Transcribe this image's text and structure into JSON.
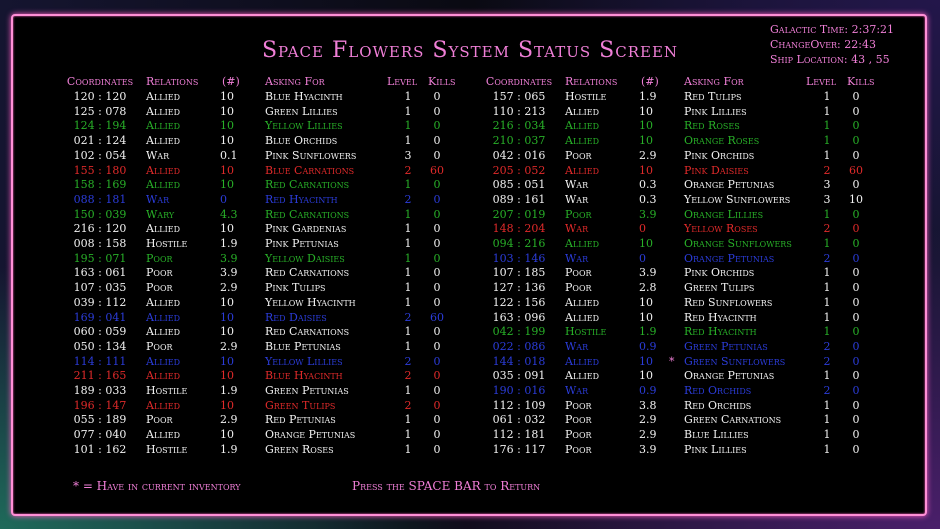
{
  "title": "Space Flowers System Status Screen",
  "status": {
    "galactic_time": "Galactic Time: 2:37:21",
    "changeover": "ChangeOver: 22:43",
    "ship_location": "Ship Location: 43 , 55"
  },
  "headers": {
    "coordinates": "Coordinates",
    "relations": "Relations",
    "num": "(#)",
    "asking_for": "Asking For",
    "level": "Level",
    "kills": "Kills"
  },
  "colors": {
    "white": "#f2f2f2",
    "green": "#28b028",
    "red": "#e02a2a",
    "blue": "#2b3cd9",
    "pink": "#f07fd7"
  },
  "left_rows": [
    {
      "coord": "120 : 120",
      "rel": "Allied",
      "num": "10",
      "ask": "Blue Hyacinth",
      "lvl": "1",
      "kills": "0",
      "color": "white"
    },
    {
      "coord": "125 : 078",
      "rel": "Allied",
      "num": "10",
      "ask": "Green Lillies",
      "lvl": "1",
      "kills": "0",
      "color": "white"
    },
    {
      "coord": "124 : 194",
      "rel": "Allied",
      "num": "10",
      "ask": "Yellow Lillies",
      "lvl": "1",
      "kills": "0",
      "color": "green"
    },
    {
      "coord": "021 : 124",
      "rel": "Allied",
      "num": "10",
      "ask": "Blue Orchids",
      "lvl": "1",
      "kills": "0",
      "color": "white"
    },
    {
      "coord": "102 : 054",
      "rel": "War",
      "num": "0.1",
      "ask": "Pink Sunflowers",
      "lvl": "3",
      "kills": "0",
      "color": "white"
    },
    {
      "coord": "155 : 180",
      "rel": "Allied",
      "num": "10",
      "ask": "Blue Carnations",
      "lvl": "2",
      "kills": "60",
      "color": "red"
    },
    {
      "coord": "158 : 169",
      "rel": "Allied",
      "num": "10",
      "ask": "Red Carnations",
      "lvl": "1",
      "kills": "0",
      "color": "green"
    },
    {
      "coord": "088 : 181",
      "rel": "War",
      "num": "0",
      "ask": "Red Hyacinth",
      "lvl": "2",
      "kills": "0",
      "color": "blue"
    },
    {
      "coord": "150 : 039",
      "rel": "Wary",
      "num": "4.3",
      "ask": "Red Carnations",
      "lvl": "1",
      "kills": "0",
      "color": "green"
    },
    {
      "coord": "216 : 120",
      "rel": "Allied",
      "num": "10",
      "ask": "Pink Gardenias",
      "lvl": "1",
      "kills": "0",
      "color": "white"
    },
    {
      "coord": "008 : 158",
      "rel": "Hostile",
      "num": "1.9",
      "ask": "Pink Petunias",
      "lvl": "1",
      "kills": "0",
      "color": "white"
    },
    {
      "coord": "195 : 071",
      "rel": "Poor",
      "num": "3.9",
      "ask": "Yellow Daisies",
      "lvl": "1",
      "kills": "0",
      "color": "green"
    },
    {
      "coord": "163 : 061",
      "rel": "Poor",
      "num": "3.9",
      "ask": "Red Carnations",
      "lvl": "1",
      "kills": "0",
      "color": "white"
    },
    {
      "coord": "107 : 035",
      "rel": "Poor",
      "num": "2.9",
      "ask": "Pink Tulips",
      "lvl": "1",
      "kills": "0",
      "color": "white"
    },
    {
      "coord": "039 : 112",
      "rel": "Allied",
      "num": "10",
      "ask": "Yellow Hyacinth",
      "lvl": "1",
      "kills": "0",
      "color": "white"
    },
    {
      "coord": "169 : 041",
      "rel": "Allied",
      "num": "10",
      "ask": "Red Daisies",
      "lvl": "2",
      "kills": "60",
      "color": "blue"
    },
    {
      "coord": "060 : 059",
      "rel": "Allied",
      "num": "10",
      "ask": "Red Carnations",
      "lvl": "1",
      "kills": "0",
      "color": "white"
    },
    {
      "coord": "050 : 134",
      "rel": "Poor",
      "num": "2.9",
      "ask": "Blue Petunias",
      "lvl": "1",
      "kills": "0",
      "color": "white"
    },
    {
      "coord": "114 : 111",
      "rel": "Allied",
      "num": "10",
      "ask": "Yellow Lillies",
      "lvl": "2",
      "kills": "0",
      "color": "blue"
    },
    {
      "coord": "211 : 165",
      "rel": "Allied",
      "num": "10",
      "ask": "Blue Hyacinth",
      "lvl": "2",
      "kills": "0",
      "color": "red"
    },
    {
      "coord": "189 : 033",
      "rel": "Hostile",
      "num": "1.9",
      "ask": "Green Petunias",
      "lvl": "1",
      "kills": "0",
      "color": "white"
    },
    {
      "coord": "196 : 147",
      "rel": "Allied",
      "num": "10",
      "ask": "Green Tulips",
      "lvl": "2",
      "kills": "0",
      "color": "red"
    },
    {
      "coord": "055 : 189",
      "rel": "Poor",
      "num": "2.9",
      "ask": "Red Petunias",
      "lvl": "1",
      "kills": "0",
      "color": "white"
    },
    {
      "coord": "077 : 040",
      "rel": "Allied",
      "num": "10",
      "ask": "Orange Petunias",
      "lvl": "1",
      "kills": "0",
      "color": "white"
    },
    {
      "coord": "101 : 162",
      "rel": "Hostile",
      "num": "1.9",
      "ask": "Green Roses",
      "lvl": "1",
      "kills": "0",
      "color": "white"
    }
  ],
  "right_rows": [
    {
      "coord": "157 : 065",
      "rel": "Hostile",
      "num": "1.9",
      "ask": "Red Tulips",
      "lvl": "1",
      "kills": "0",
      "color": "white",
      "star": ""
    },
    {
      "coord": "110 : 213",
      "rel": "Allied",
      "num": "10",
      "ask": "Pink Lillies",
      "lvl": "1",
      "kills": "0",
      "color": "white",
      "star": ""
    },
    {
      "coord": "216 : 034",
      "rel": "Allied",
      "num": "10",
      "ask": "Red Roses",
      "lvl": "1",
      "kills": "0",
      "color": "green",
      "star": ""
    },
    {
      "coord": "210 : 037",
      "rel": "Allied",
      "num": "10",
      "ask": "Orange Roses",
      "lvl": "1",
      "kills": "0",
      "color": "green",
      "star": ""
    },
    {
      "coord": "042 : 016",
      "rel": "Poor",
      "num": "2.9",
      "ask": "Pink Orchids",
      "lvl": "1",
      "kills": "0",
      "color": "white",
      "star": ""
    },
    {
      "coord": "205 : 052",
      "rel": "Allied",
      "num": "10",
      "ask": "Pink Daisies",
      "lvl": "2",
      "kills": "60",
      "color": "red",
      "star": ""
    },
    {
      "coord": "085 : 051",
      "rel": "War",
      "num": "0.3",
      "ask": "Orange Petunias",
      "lvl": "3",
      "kills": "0",
      "color": "white",
      "star": ""
    },
    {
      "coord": "089 : 161",
      "rel": "War",
      "num": "0.3",
      "ask": "Yellow Sunflowers",
      "lvl": "3",
      "kills": "10",
      "color": "white",
      "star": ""
    },
    {
      "coord": "207 : 019",
      "rel": "Poor",
      "num": "3.9",
      "ask": "Orange Lillies",
      "lvl": "1",
      "kills": "0",
      "color": "green",
      "star": ""
    },
    {
      "coord": "148 : 204",
      "rel": "War",
      "num": "0",
      "ask": "Yellow Roses",
      "lvl": "2",
      "kills": "0",
      "color": "red",
      "star": ""
    },
    {
      "coord": "094 : 216",
      "rel": "Allied",
      "num": "10",
      "ask": "Orange Sunflowers",
      "lvl": "1",
      "kills": "0",
      "color": "green",
      "star": ""
    },
    {
      "coord": "103 : 146",
      "rel": "War",
      "num": "0",
      "ask": "Orange Petunias",
      "lvl": "2",
      "kills": "0",
      "color": "blue",
      "star": ""
    },
    {
      "coord": "107 : 185",
      "rel": "Poor",
      "num": "3.9",
      "ask": "Pink Orchids",
      "lvl": "1",
      "kills": "0",
      "color": "white",
      "star": ""
    },
    {
      "coord": "127 : 136",
      "rel": "Poor",
      "num": "2.8",
      "ask": "Green Tulips",
      "lvl": "1",
      "kills": "0",
      "color": "white",
      "star": ""
    },
    {
      "coord": "122 : 156",
      "rel": "Allied",
      "num": "10",
      "ask": "Red Sunflowers",
      "lvl": "1",
      "kills": "0",
      "color": "white",
      "star": ""
    },
    {
      "coord": "163 : 096",
      "rel": "Allied",
      "num": "10",
      "ask": "Red Hyacinth",
      "lvl": "1",
      "kills": "0",
      "color": "white",
      "star": ""
    },
    {
      "coord": "042 : 199",
      "rel": "Hostile",
      "num": "1.9",
      "ask": "Red Hyacinth",
      "lvl": "1",
      "kills": "0",
      "color": "green",
      "star": ""
    },
    {
      "coord": "022 : 086",
      "rel": "War",
      "num": "0.9",
      "ask": "Green Petunias",
      "lvl": "2",
      "kills": "0",
      "color": "blue",
      "star": ""
    },
    {
      "coord": "144 : 018",
      "rel": "Allied",
      "num": "10",
      "ask": "Green Sunflowers",
      "lvl": "2",
      "kills": "0",
      "color": "blue",
      "star": "*"
    },
    {
      "coord": "035 : 091",
      "rel": "Allied",
      "num": "10",
      "ask": "Orange Petunias",
      "lvl": "1",
      "kills": "0",
      "color": "white",
      "star": ""
    },
    {
      "coord": "190 : 016",
      "rel": "War",
      "num": "0.9",
      "ask": "Red Orchids",
      "lvl": "2",
      "kills": "0",
      "color": "blue",
      "star": ""
    },
    {
      "coord": "112 : 109",
      "rel": "Poor",
      "num": "3.8",
      "ask": "Red Orchids",
      "lvl": "1",
      "kills": "0",
      "color": "white",
      "star": ""
    },
    {
      "coord": "061 : 032",
      "rel": "Poor",
      "num": "2.9",
      "ask": "Green Carnations",
      "lvl": "1",
      "kills": "0",
      "color": "white",
      "star": ""
    },
    {
      "coord": "112 : 181",
      "rel": "Poor",
      "num": "2.9",
      "ask": "Blue Lillies",
      "lvl": "1",
      "kills": "0",
      "color": "white",
      "star": ""
    },
    {
      "coord": "176 : 117",
      "rel": "Poor",
      "num": "3.9",
      "ask": "Pink Lillies",
      "lvl": "1",
      "kills": "0",
      "color": "white",
      "star": ""
    }
  ],
  "footer": {
    "inventory_note": "* = Have in current inventory",
    "return_prompt": "Press the SPACE BAR to Return"
  }
}
